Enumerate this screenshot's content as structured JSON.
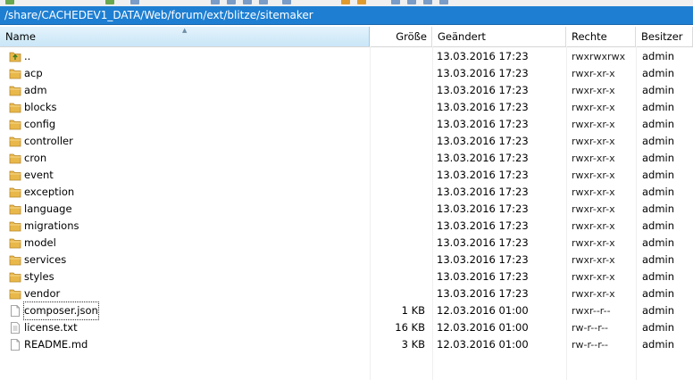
{
  "path": "/share/CACHEDEV1_DATA/Web/forum/ext/blitze/sitemaker",
  "columns": {
    "name": "Name",
    "size": "Größe",
    "modified": "Geändert",
    "permissions": "Rechte",
    "owner": "Besitzer"
  },
  "files": [
    {
      "name": "..",
      "icon": "folder-up-icon",
      "size": "",
      "modified": "13.03.2016 17:23",
      "permissions": "rwxrwxrwx",
      "owner": "admin"
    },
    {
      "name": "acp",
      "icon": "folder-icon",
      "size": "",
      "modified": "13.03.2016 17:23",
      "permissions": "rwxr-xr-x",
      "owner": "admin"
    },
    {
      "name": "adm",
      "icon": "folder-icon",
      "size": "",
      "modified": "13.03.2016 17:23",
      "permissions": "rwxr-xr-x",
      "owner": "admin"
    },
    {
      "name": "blocks",
      "icon": "folder-icon",
      "size": "",
      "modified": "13.03.2016 17:23",
      "permissions": "rwxr-xr-x",
      "owner": "admin"
    },
    {
      "name": "config",
      "icon": "folder-icon",
      "size": "",
      "modified": "13.03.2016 17:23",
      "permissions": "rwxr-xr-x",
      "owner": "admin"
    },
    {
      "name": "controller",
      "icon": "folder-icon",
      "size": "",
      "modified": "13.03.2016 17:23",
      "permissions": "rwxr-xr-x",
      "owner": "admin"
    },
    {
      "name": "cron",
      "icon": "folder-icon",
      "size": "",
      "modified": "13.03.2016 17:23",
      "permissions": "rwxr-xr-x",
      "owner": "admin"
    },
    {
      "name": "event",
      "icon": "folder-icon",
      "size": "",
      "modified": "13.03.2016 17:23",
      "permissions": "rwxr-xr-x",
      "owner": "admin"
    },
    {
      "name": "exception",
      "icon": "folder-icon",
      "size": "",
      "modified": "13.03.2016 17:23",
      "permissions": "rwxr-xr-x",
      "owner": "admin"
    },
    {
      "name": "language",
      "icon": "folder-icon",
      "size": "",
      "modified": "13.03.2016 17:23",
      "permissions": "rwxr-xr-x",
      "owner": "admin"
    },
    {
      "name": "migrations",
      "icon": "folder-icon",
      "size": "",
      "modified": "13.03.2016 17:23",
      "permissions": "rwxr-xr-x",
      "owner": "admin"
    },
    {
      "name": "model",
      "icon": "folder-icon",
      "size": "",
      "modified": "13.03.2016 17:23",
      "permissions": "rwxr-xr-x",
      "owner": "admin"
    },
    {
      "name": "services",
      "icon": "folder-icon",
      "size": "",
      "modified": "13.03.2016 17:23",
      "permissions": "rwxr-xr-x",
      "owner": "admin"
    },
    {
      "name": "styles",
      "icon": "folder-icon",
      "size": "",
      "modified": "13.03.2016 17:23",
      "permissions": "rwxr-xr-x",
      "owner": "admin"
    },
    {
      "name": "vendor",
      "icon": "folder-icon",
      "size": "",
      "modified": "13.03.2016 17:23",
      "permissions": "rwxr-xr-x",
      "owner": "admin"
    },
    {
      "name": "composer.json",
      "icon": "file-icon",
      "size": "1 KB",
      "modified": "12.03.2016 01:00",
      "permissions": "rwxr--r--",
      "owner": "admin",
      "focused": true
    },
    {
      "name": "license.txt",
      "icon": "text-file-icon",
      "size": "16 KB",
      "modified": "12.03.2016 01:00",
      "permissions": "rw-r--r--",
      "owner": "admin"
    },
    {
      "name": "README.md",
      "icon": "file-icon",
      "size": "3 KB",
      "modified": "12.03.2016 01:00",
      "permissions": "rw-r--r--",
      "owner": "admin"
    }
  ],
  "colors": {
    "pathbar": "#1e7fd2",
    "folder": "#e8b84a",
    "sorted_header": "#d3ecfa"
  }
}
